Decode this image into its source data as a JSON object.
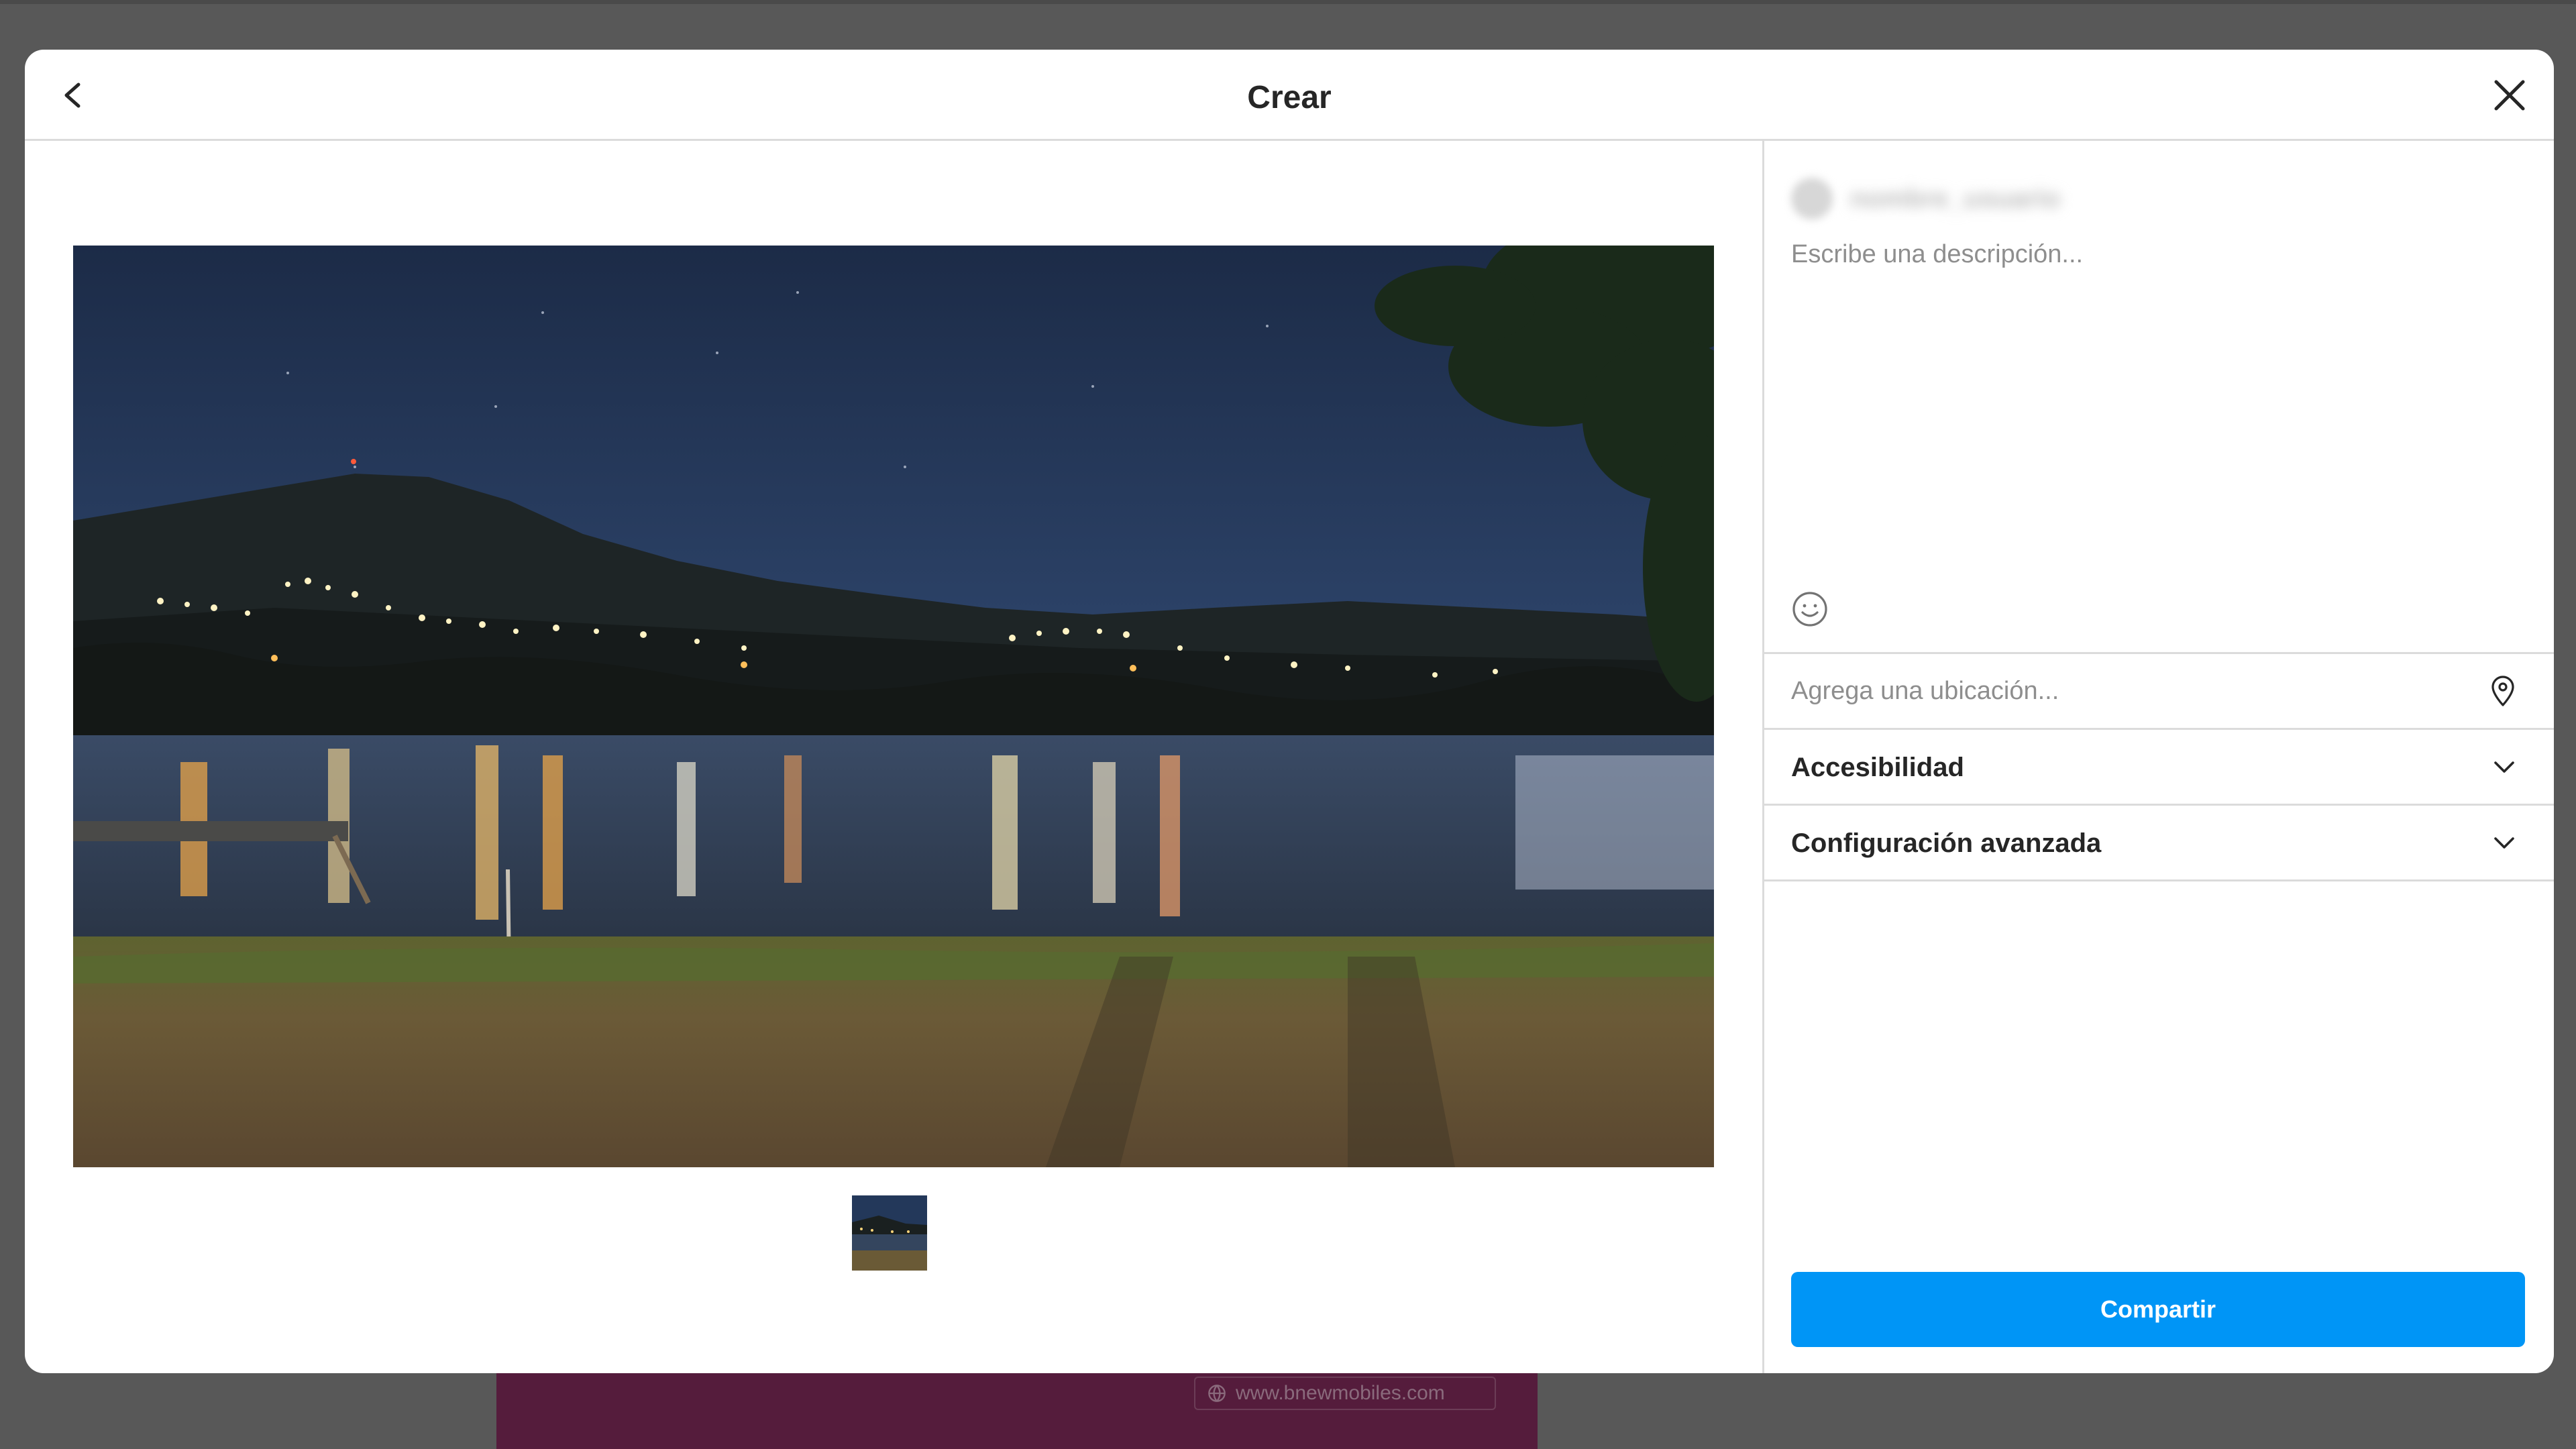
{
  "background": {
    "url_text": "www.bnewmobiles.com"
  },
  "modal": {
    "title": "Crear"
  },
  "sidebar": {
    "username": "nombre_usuario",
    "caption_placeholder": "Escribe una descripción...",
    "location_placeholder": "Agrega una ubicación...",
    "accessibility_label": "Accesibilidad",
    "advanced_label": "Configuración avanzada",
    "share_label": "Compartir"
  },
  "icons": {
    "back": "chevron-left-icon",
    "close": "close-icon",
    "emoji": "emoji-icon",
    "location": "location-pin-icon",
    "expand": "chevron-down-icon"
  },
  "colors": {
    "accent": "#0095f6",
    "overlay": "#585858",
    "border": "#dbdbdb",
    "text": "#262626",
    "placeholder": "#8e8e8e"
  }
}
